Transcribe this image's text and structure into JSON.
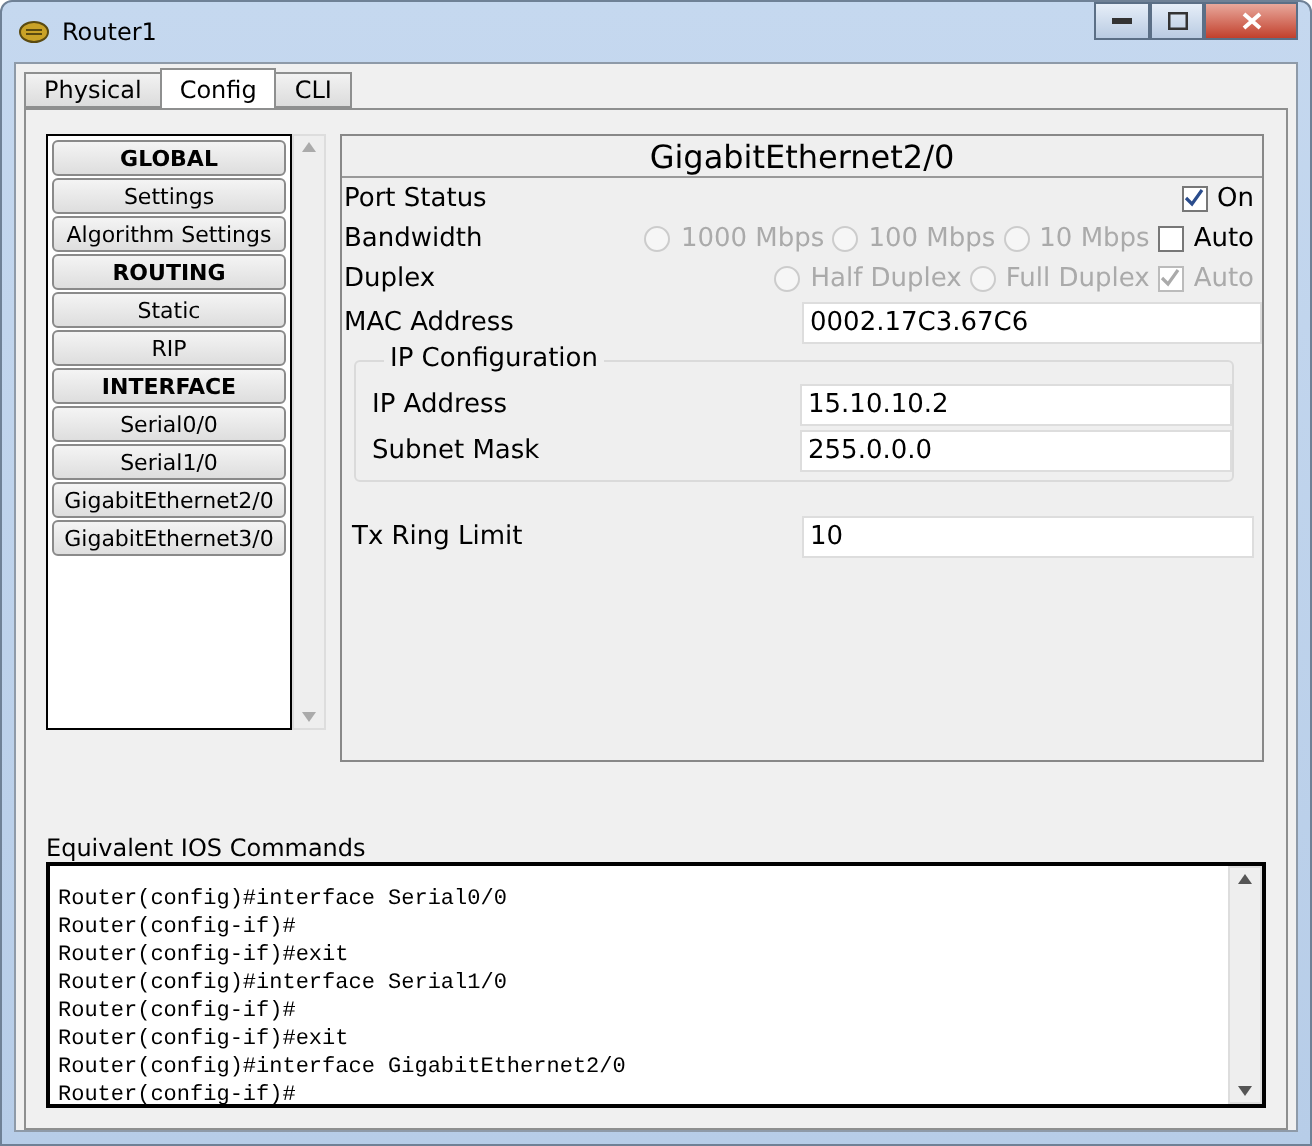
{
  "window": {
    "title": "Router1"
  },
  "tabs": [
    {
      "label": "Physical",
      "selected": false
    },
    {
      "label": "Config",
      "selected": true
    },
    {
      "label": "CLI",
      "selected": false
    }
  ],
  "sidebar": {
    "items": [
      {
        "label": "GLOBAL",
        "kind": "header"
      },
      {
        "label": "Settings",
        "kind": "item"
      },
      {
        "label": "Algorithm Settings",
        "kind": "item"
      },
      {
        "label": "ROUTING",
        "kind": "header"
      },
      {
        "label": "Static",
        "kind": "item"
      },
      {
        "label": "RIP",
        "kind": "item"
      },
      {
        "label": "INTERFACE",
        "kind": "header"
      },
      {
        "label": "Serial0/0",
        "kind": "item"
      },
      {
        "label": "Serial1/0",
        "kind": "item"
      },
      {
        "label": "GigabitEthernet2/0",
        "kind": "item"
      },
      {
        "label": "GigabitEthernet3/0",
        "kind": "item"
      }
    ]
  },
  "panel": {
    "title": "GigabitEthernet2/0",
    "options": [
      {
        "label": "Port Status",
        "choices": [
          {
            "kind": "checkbox",
            "label": "On",
            "checked": true,
            "disabled": false
          }
        ]
      },
      {
        "label": "Bandwidth",
        "choices": [
          {
            "kind": "radio",
            "label": "1000 Mbps",
            "checked": false,
            "disabled": true
          },
          {
            "kind": "radio",
            "label": "100 Mbps",
            "checked": false,
            "disabled": true
          },
          {
            "kind": "radio",
            "label": "10 Mbps",
            "checked": false,
            "disabled": true
          },
          {
            "kind": "checkbox",
            "label": "Auto",
            "checked": false,
            "disabled": false
          }
        ]
      },
      {
        "label": "Duplex",
        "choices": [
          {
            "kind": "radio",
            "label": "Half Duplex",
            "checked": false,
            "disabled": true
          },
          {
            "kind": "radio",
            "label": "Full Duplex",
            "checked": false,
            "disabled": true
          },
          {
            "kind": "checkbox",
            "label": "Auto",
            "checked": true,
            "disabled": true
          }
        ]
      }
    ],
    "mac": {
      "label": "MAC Address",
      "value": "0002.17C3.67C6"
    },
    "ip_config": {
      "title": "IP Configuration",
      "fields": [
        {
          "label": "IP Address",
          "value": "15.10.10.2"
        },
        {
          "label": "Subnet Mask",
          "value": "255.0.0.0"
        }
      ]
    },
    "tx_ring": {
      "label": "Tx Ring Limit",
      "value": "10"
    }
  },
  "console": {
    "label": "Equivalent IOS Commands",
    "lines": [
      "Router(config)#interface Serial0/0",
      "Router(config-if)#",
      "Router(config-if)#exit",
      "Router(config)#interface Serial1/0",
      "Router(config-if)#",
      "Router(config-if)#exit",
      "Router(config)#interface GigabitEthernet2/0",
      "Router(config-if)#"
    ]
  }
}
